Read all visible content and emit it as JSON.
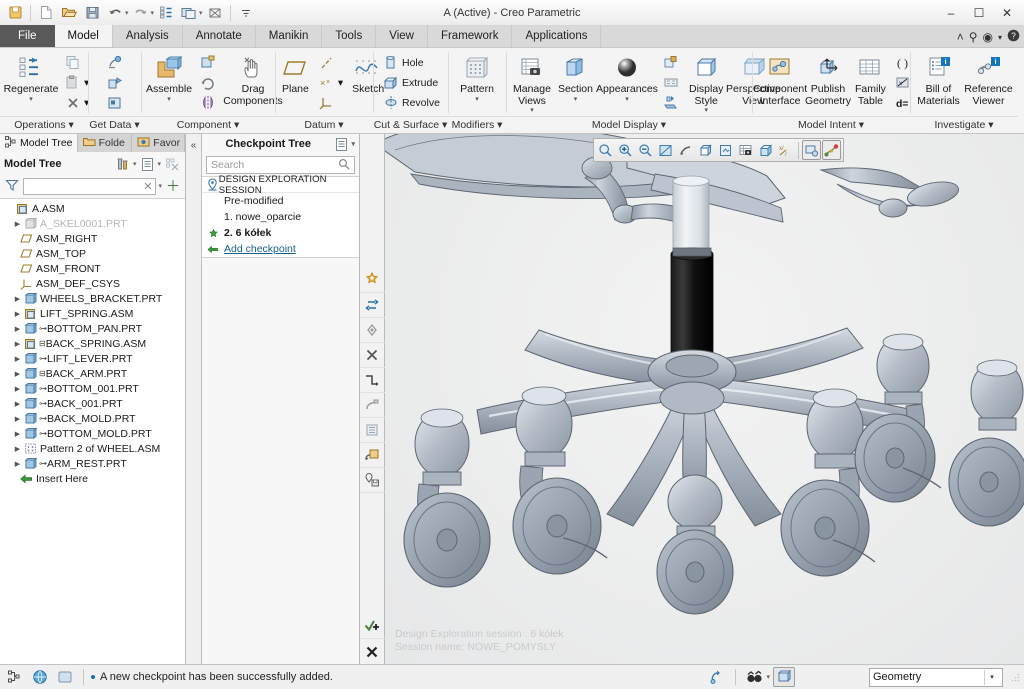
{
  "window": {
    "title": "A (Active) - Creo Parametric",
    "minimize": "–",
    "maximize": "☐",
    "close": "✕"
  },
  "quick_access": [
    {
      "name": "save-as-copy-icon",
      "glyph": "❐"
    },
    {
      "name": "new-icon",
      "glyph": "□"
    },
    {
      "name": "open-icon",
      "glyph": "▱"
    },
    {
      "name": "save-icon",
      "glyph": "▣"
    },
    {
      "name": "undo-icon",
      "glyph": "↶"
    },
    {
      "name": "redo-icon",
      "glyph": "↷"
    },
    {
      "name": "regenerate-icon",
      "glyph": "☲"
    },
    {
      "name": "window-icon",
      "glyph": "❐"
    },
    {
      "name": "close-window-icon",
      "glyph": "⌧"
    },
    {
      "name": "customize-qat-icon",
      "glyph": "▾"
    }
  ],
  "ribbon": {
    "tabs": [
      {
        "label": "File",
        "active": false,
        "file": true
      },
      {
        "label": "Model",
        "active": true,
        "file": false
      },
      {
        "label": "Analysis",
        "active": false,
        "file": false
      },
      {
        "label": "Annotate",
        "active": false,
        "file": false
      },
      {
        "label": "Manikin",
        "active": false,
        "file": false
      },
      {
        "label": "Tools",
        "active": false,
        "file": false
      },
      {
        "label": "View",
        "active": false,
        "file": false
      },
      {
        "label": "Framework",
        "active": false,
        "file": false
      },
      {
        "label": "Applications",
        "active": false,
        "file": false
      }
    ],
    "right_icons": [
      {
        "name": "collapse-ribbon-icon",
        "glyph": "˄"
      },
      {
        "name": "search-icon",
        "glyph": "⚲"
      },
      {
        "name": "account-icon",
        "glyph": "◉"
      },
      {
        "name": "account-dropdown-icon",
        "glyph": "▾"
      },
      {
        "name": "help-icon",
        "glyph": "❓"
      }
    ],
    "groups": [
      {
        "name": "operations",
        "label": "Operations",
        "big": [
          {
            "label": "Regenerate",
            "caret": true,
            "icon": "regenerate-icon"
          }
        ],
        "small": [
          {
            "label": "",
            "icon": "copy-icon"
          },
          {
            "label": "",
            "icon": "paste-icon",
            "caret": true
          },
          {
            "label": "",
            "icon": "delete-icon",
            "caret": true
          }
        ]
      },
      {
        "name": "get-data",
        "label": "Get Data",
        "big": [],
        "small": [
          {
            "label": "",
            "icon": "import-icon"
          },
          {
            "label": "",
            "icon": "merge-icon"
          },
          {
            "label": "",
            "icon": "shrinkwrap-icon"
          }
        ]
      },
      {
        "name": "component",
        "label": "Component",
        "big": [
          {
            "label": "Assemble",
            "caret": true,
            "icon": "assemble-icon"
          },
          {
            "label": "Drag Components",
            "caret": false,
            "icon": "drag-components-icon"
          }
        ],
        "small": [
          {
            "label": "",
            "icon": "create-component-icon"
          },
          {
            "label": "",
            "icon": "repeat-icon"
          },
          {
            "label": "",
            "icon": "mirror-component-icon"
          }
        ]
      },
      {
        "name": "datum",
        "label": "Datum",
        "big": [
          {
            "label": "Plane",
            "caret": false,
            "icon": "datum-plane-icon"
          },
          {
            "label": "Sketch",
            "caret": false,
            "icon": "sketch-icon"
          }
        ],
        "small": [
          {
            "label": "",
            "icon": "datum-axis-icon"
          },
          {
            "label": "",
            "icon": "datum-point-icon",
            "caret": true
          },
          {
            "label": "",
            "icon": "coordinate-system-icon"
          }
        ]
      },
      {
        "name": "cut-and-surface",
        "label": "Cut & Surface",
        "big": [],
        "small": [
          {
            "label": "Hole",
            "icon": "hole-icon"
          },
          {
            "label": "Extrude",
            "icon": "extrude-icon"
          },
          {
            "label": "Revolve",
            "icon": "revolve-icon"
          }
        ]
      },
      {
        "name": "modifiers",
        "label": "Modifiers",
        "big": [
          {
            "label": "Pattern",
            "caret": true,
            "icon": "pattern-icon"
          }
        ],
        "small": []
      },
      {
        "name": "model-display",
        "label": "Model Display",
        "big": [
          {
            "label": "Manage Views",
            "caret": true,
            "icon": "manage-views-icon"
          },
          {
            "label": "Section",
            "caret": true,
            "icon": "section-icon"
          },
          {
            "label": "Appearances",
            "caret": true,
            "icon": "appearances-icon"
          },
          {
            "label": "Display Style",
            "caret": true,
            "icon": "display-style-icon"
          },
          {
            "label": "Perspective View",
            "caret": false,
            "icon": "perspective-view-icon"
          }
        ],
        "small": [
          {
            "label": "",
            "icon": "layer-icon"
          },
          {
            "label": "",
            "icon": "name-display-icon"
          },
          {
            "label": "",
            "icon": "view-manager-icon"
          }
        ]
      },
      {
        "name": "model-intent",
        "label": "Model Intent",
        "big": [
          {
            "label": "Component Interface",
            "caret": false,
            "icon": "component-interface-icon"
          },
          {
            "label": "Publish Geometry",
            "caret": false,
            "icon": "publish-geometry-icon"
          },
          {
            "label": "Family Table",
            "caret": false,
            "icon": "family-table-icon"
          }
        ],
        "small": [
          {
            "label": "",
            "icon": "parameters-icon"
          },
          {
            "label": "",
            "icon": "relations-icon"
          },
          {
            "label": "",
            "icon": "switch-dimensions-icon"
          }
        ]
      },
      {
        "name": "investigate",
        "label": "Investigate",
        "big": [
          {
            "label": "Bill of Materials",
            "caret": false,
            "icon": "bill-of-materials-icon"
          },
          {
            "label": "Reference Viewer",
            "caret": false,
            "icon": "reference-viewer-icon"
          }
        ],
        "small": []
      }
    ]
  },
  "navigator": {
    "tabs": [
      {
        "label": "Model Tree",
        "icon": "model-tree-icon",
        "active": true
      },
      {
        "label": "Folde",
        "icon": "folder-browser-icon",
        "active": false
      },
      {
        "label": "Favor",
        "icon": "favorites-icon",
        "active": false
      }
    ],
    "toolbar_title": "Model Tree",
    "toolbar_icons": [
      {
        "name": "tree-settings-icon",
        "glyph": "⚙"
      },
      {
        "name": "tree-settings-dropdown-icon",
        "glyph": "▾"
      },
      {
        "name": "tree-columns-icon",
        "glyph": "☰"
      },
      {
        "name": "tree-columns-dropdown-icon",
        "glyph": "▾"
      },
      {
        "name": "tree-filter-display-icon",
        "glyph": "▦"
      }
    ],
    "filter": {
      "placeholder": "",
      "value": "",
      "clear_glyph": "✕",
      "dropdown_glyph": "▾",
      "add_glyph": "＋"
    },
    "tree": [
      {
        "label": "A.ASM",
        "indent": 0,
        "arrow": false,
        "icon": "assembly-icon",
        "dim": false,
        "footnote": false
      },
      {
        "label": "A_SKEL0001.PRT",
        "indent": 1,
        "arrow": true,
        "icon": "part-icon",
        "dim": true,
        "footnote": false
      },
      {
        "label": "ASM_RIGHT",
        "indent": 1,
        "arrow": false,
        "icon": "datum-plane-icon",
        "dim": false,
        "footnote": false
      },
      {
        "label": "ASM_TOP",
        "indent": 1,
        "arrow": false,
        "icon": "datum-plane-icon",
        "dim": false,
        "footnote": false
      },
      {
        "label": "ASM_FRONT",
        "indent": 1,
        "arrow": false,
        "icon": "datum-plane-icon",
        "dim": false,
        "footnote": false
      },
      {
        "label": "ASM_DEF_CSYS",
        "indent": 1,
        "arrow": false,
        "icon": "coordinate-system-icon",
        "dim": false,
        "footnote": false
      },
      {
        "label": "WHEELS_BRACKET.PRT",
        "indent": 1,
        "arrow": true,
        "icon": "part-icon",
        "dim": false,
        "footnote": false
      },
      {
        "label": "LIFT_SPRING.ASM",
        "indent": 1,
        "arrow": true,
        "icon": "assembly-icon",
        "dim": false,
        "footnote": false
      },
      {
        "label": "BOTTOM_PAN.PRT",
        "indent": 1,
        "arrow": true,
        "icon": "part-icon",
        "dim": false,
        "footnote": true
      },
      {
        "label": "BACK_SPRING.ASM",
        "indent": 1,
        "arrow": true,
        "icon": "assembly-icon",
        "dim": false,
        "footnote": true
      },
      {
        "label": "LIFT_LEVER.PRT",
        "indent": 1,
        "arrow": true,
        "icon": "part-icon",
        "dim": false,
        "footnote": true
      },
      {
        "label": "BACK_ARM.PRT",
        "indent": 1,
        "arrow": true,
        "icon": "part-icon",
        "dim": false,
        "footnote": true
      },
      {
        "label": "BOTTOM_001.PRT",
        "indent": 1,
        "arrow": true,
        "icon": "part-icon",
        "dim": false,
        "footnote": true
      },
      {
        "label": "BACK_001.PRT",
        "indent": 1,
        "arrow": true,
        "icon": "part-icon",
        "dim": false,
        "footnote": true
      },
      {
        "label": "BACK_MOLD.PRT",
        "indent": 1,
        "arrow": true,
        "icon": "part-icon",
        "dim": false,
        "footnote": true
      },
      {
        "label": "BOTTOM_MOLD.PRT",
        "indent": 1,
        "arrow": true,
        "icon": "part-icon",
        "dim": false,
        "footnote": true
      },
      {
        "label": "Pattern 2 of WHEEL.ASM",
        "indent": 1,
        "arrow": true,
        "icon": "pattern-icon",
        "dim": false,
        "footnote": false
      },
      {
        "label": "ARM_REST.PRT",
        "indent": 1,
        "arrow": true,
        "icon": "part-icon",
        "dim": false,
        "footnote": true
      },
      {
        "label": "Insert Here",
        "indent": 1,
        "arrow": false,
        "icon": "insert-here-icon",
        "dim": false,
        "footnote": false
      }
    ]
  },
  "collapse_strip": {
    "glyph": "«"
  },
  "checkpoint_tree": {
    "title": "Checkpoint Tree",
    "header_icons": [
      {
        "name": "checkpoint-options-icon",
        "glyph": "☰"
      },
      {
        "name": "checkpoint-dropdown-icon",
        "glyph": "▾"
      }
    ],
    "search": {
      "placeholder": "Search",
      "value": "",
      "icon": "search-icon"
    },
    "rows": [
      {
        "label": "DESIGN EXPLORATION SESSION",
        "icon": "session-pin-icon",
        "style": "session"
      },
      {
        "label": "Pre-modified",
        "icon": "",
        "style": "indent"
      },
      {
        "label": "1. nowe_oparcie",
        "icon": "",
        "style": "indent"
      },
      {
        "label": "2. 6 kółek",
        "icon": "checkpoint-current-icon",
        "style": "bold"
      },
      {
        "label": "Add checkpoint",
        "icon": "add-checkpoint-icon",
        "style": "link"
      }
    ]
  },
  "vertical_toolbar": {
    "top": [
      {
        "name": "checkpoint-marker-icon",
        "glyph": "✸",
        "color": "#f0a830"
      },
      {
        "name": "swap-checkpoint-icon",
        "glyph": "⇄",
        "color": "#1f6fae"
      },
      {
        "name": "set-current-icon",
        "glyph": "◇",
        "color": "#8a8a8a"
      },
      {
        "name": "remove-checkpoint-icon",
        "glyph": "✕",
        "color": "#5a5a5a"
      },
      {
        "name": "branch-icon",
        "glyph": "┙",
        "color": "#4b4b4b"
      },
      {
        "name": "compare-icon",
        "glyph": "↱",
        "color": "#9a9a9a"
      },
      {
        "name": "list-checkpoints-icon",
        "glyph": "☷",
        "color": "#9a9a9a"
      },
      {
        "name": "copy-geometry-icon",
        "glyph": "⧉",
        "color": "#6b6b6b"
      },
      {
        "name": "save-checkpoint-icon",
        "glyph": "⚲",
        "color": "#6b6b6b"
      }
    ],
    "bottom": [
      {
        "name": "accept-session-icon",
        "glyph": "✔",
        "color": "#4e7d3a"
      },
      {
        "name": "cancel-session-icon",
        "glyph": "✕",
        "color": "#333333"
      }
    ]
  },
  "graphics_toolbar": [
    {
      "name": "refit-icon",
      "glyph": "⌕",
      "framed": false
    },
    {
      "name": "zoom-in-icon",
      "glyph": "⊕",
      "framed": false
    },
    {
      "name": "zoom-out-icon",
      "glyph": "⊖",
      "framed": false
    },
    {
      "name": "repaint-icon",
      "glyph": "◧",
      "framed": false
    },
    {
      "name": "spin-center-icon",
      "glyph": "⤵",
      "framed": false
    },
    {
      "name": "display-style-icon",
      "glyph": "▧",
      "framed": false
    },
    {
      "name": "saved-view-icon",
      "glyph": "◱",
      "framed": false
    },
    {
      "name": "view-manager-icon",
      "glyph": "⌸",
      "framed": false
    },
    {
      "name": "perspective-icon",
      "glyph": "⬟",
      "framed": false
    },
    {
      "name": "datum-display-icon",
      "glyph": "✳",
      "framed": false
    },
    {
      "name": "annotation-display-icon",
      "glyph": "❐",
      "framed": true
    },
    {
      "name": "spin-drag-icon",
      "glyph": "⊹",
      "framed": true
    }
  ],
  "graphics_watermark": {
    "line1": "Design Exploration session : 6 kółek",
    "line2": "Session name: NOWE_POMYSLY"
  },
  "status_bar": {
    "left_icons": [
      {
        "name": "model-tree-toggle-icon",
        "glyph": "☲"
      },
      {
        "name": "web-browser-icon",
        "glyph": "◉"
      },
      {
        "name": "graphics-window-icon",
        "glyph": "□"
      }
    ],
    "message": "A new checkpoint has been successfully added.",
    "right_icons": [
      {
        "name": "regenerate-status-icon",
        "glyph": "↻"
      },
      {
        "name": "search-tool-icon",
        "glyph": "☌"
      },
      {
        "name": "search-dropdown-icon",
        "glyph": "▾"
      },
      {
        "name": "selection-box-icon",
        "glyph": "⧉"
      }
    ],
    "filter": {
      "value": "Geometry",
      "caret": "▾"
    }
  },
  "colors": {
    "accent_blue": "#1a6fb5",
    "ribbon_bg": "#f4f4f4",
    "tab_active": "#f4f4f4",
    "file_tab": "#595959",
    "link": "#17618a",
    "model_gray": "#b4bcc6",
    "graphics_bg": "#ececed"
  }
}
